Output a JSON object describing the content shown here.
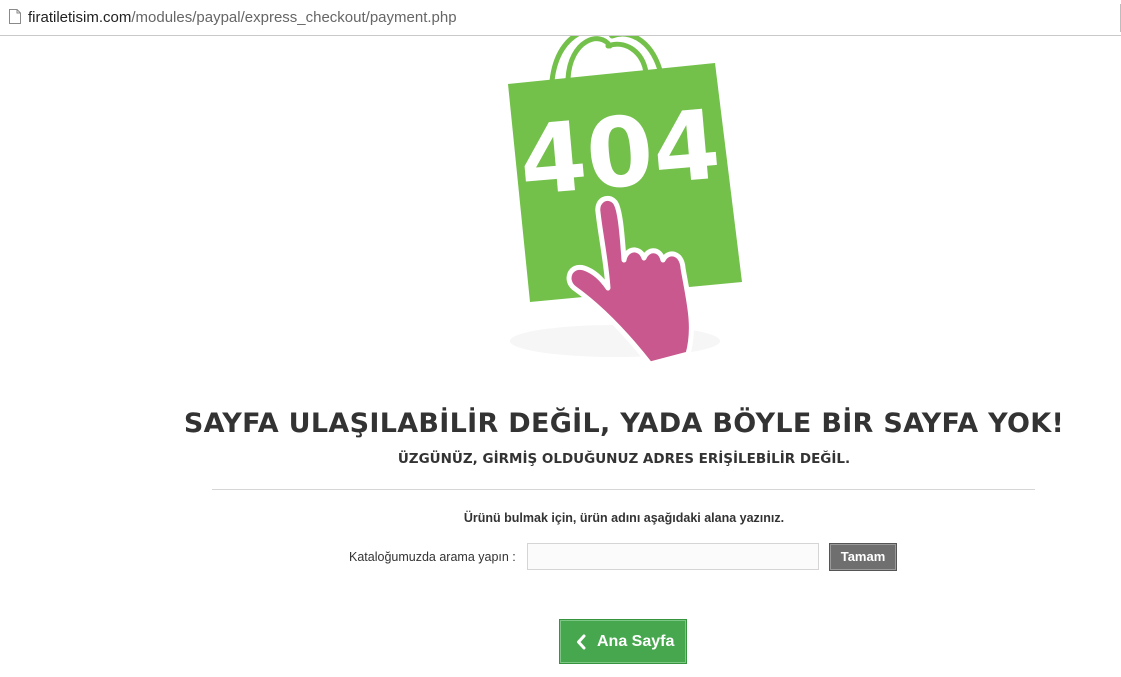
{
  "browser": {
    "url_host": "firatiletisim.com",
    "url_path": "/modules/paypal/express_checkout/payment.php"
  },
  "illustration": {
    "bag_text": "404",
    "bag_color": "#73c04b",
    "hand_color": "#c8588d"
  },
  "error": {
    "title": "SAYFA ULAŞILABİLİR DEĞİL, YADA BÖYLE BİR SAYFA YOK!",
    "subtitle": "ÜZGÜNÜZ, GİRMİŞ OLDUĞUNUZ ADRES ERİŞİLEBİLİR DEĞİL."
  },
  "search": {
    "hint": "Ürünü bulmak için, ürün adını aşağıdaki alana yazınız.",
    "label": "Kataloğumuzda arama yapın :",
    "value": "",
    "placeholder": "",
    "button_label": "Tamam"
  },
  "home": {
    "label": "Ana Sayfa",
    "color": "#46a74e"
  }
}
